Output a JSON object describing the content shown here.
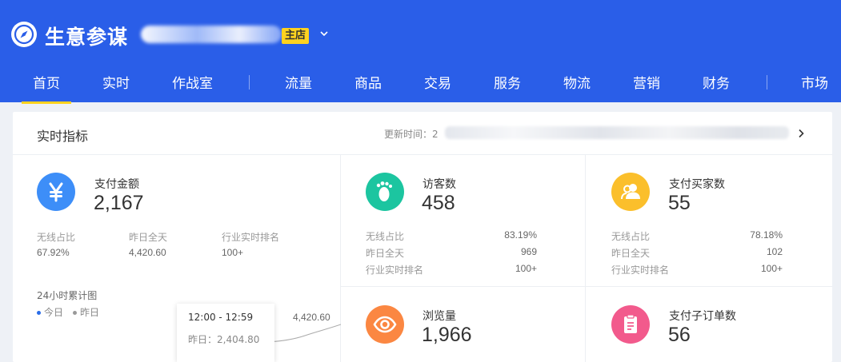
{
  "header": {
    "brand": "生意参谋",
    "shop_tag": "主店",
    "nav": [
      {
        "label": "首页"
      },
      {
        "label": "实时"
      },
      {
        "label": "作战室"
      },
      {
        "label": "流量"
      },
      {
        "label": "商品"
      },
      {
        "label": "交易"
      },
      {
        "label": "服务"
      },
      {
        "label": "物流"
      },
      {
        "label": "营销"
      },
      {
        "label": "财务"
      },
      {
        "label": "市场"
      }
    ]
  },
  "realtime": {
    "title": "实时指标",
    "update_label": "更新时间：2",
    "metrics": {
      "pay_amount": {
        "name": "支付金额",
        "value": "2,167",
        "icon": "yen-icon",
        "color": "#3d8ef8",
        "wireless_label": "无线占比",
        "wireless_value": "67.92%",
        "yesterday_label": "昨日全天",
        "yesterday_value": "4,420.60",
        "rank_label": "行业实时排名",
        "rank_value": "100+"
      },
      "visitors": {
        "name": "访客数",
        "value": "458",
        "icon": "footprint-icon",
        "color": "#1cc5a0",
        "wireless_label": "无线占比",
        "wireless_value": "83.19%",
        "yesterday_label": "昨日全天",
        "yesterday_value": "969",
        "rank_label": "行业实时排名",
        "rank_value": "100+"
      },
      "buyers": {
        "name": "支付买家数",
        "value": "55",
        "icon": "users-icon",
        "color": "#fbbf2b",
        "wireless_label": "无线占比",
        "wireless_value": "78.18%",
        "yesterday_label": "昨日全天",
        "yesterday_value": "102",
        "rank_label": "行业实时排名",
        "rank_value": "100+"
      },
      "pageviews": {
        "name": "浏览量",
        "value": "1,966",
        "icon": "eye-icon",
        "color": "#fb8742"
      },
      "sub_orders": {
        "name": "支付子订单数",
        "value": "56",
        "icon": "clipboard-icon",
        "color": "#f25a8c"
      }
    },
    "chart": {
      "title": "24小时累计图",
      "legend_today": "今日",
      "legend_yesterday": "昨日",
      "today_color": "#2a6de8",
      "yesterday_color": "#999999",
      "tooltip_time": "12:00 - 12:59",
      "tooltip_yesterday": "昨日：2,404.80",
      "end_value": "4,420.60"
    }
  }
}
